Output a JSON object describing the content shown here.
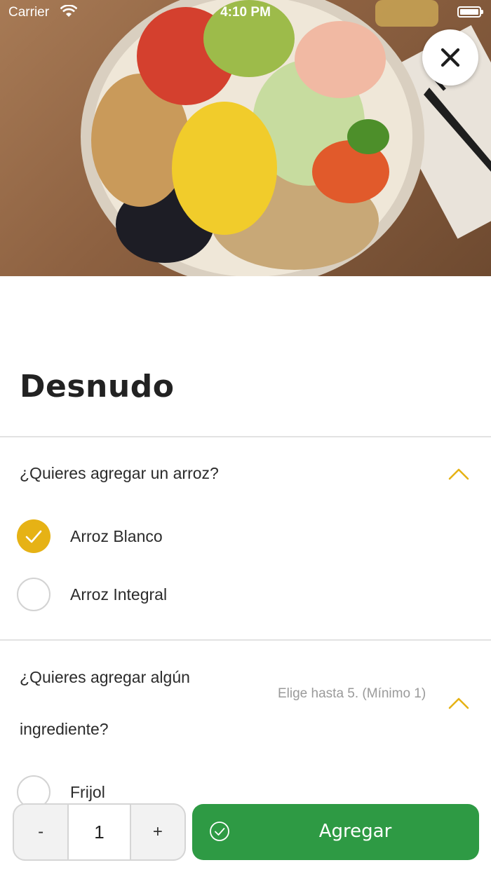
{
  "status_bar": {
    "carrier": "Carrier",
    "time": "4:10 PM"
  },
  "hero": {
    "image_description_icon": "food-photo-icon"
  },
  "product": {
    "title": "Desnudo"
  },
  "sections": [
    {
      "title": "¿Quieres agregar un arroz?",
      "options": [
        {
          "label": "Arroz Blanco",
          "selected": true
        },
        {
          "label": "Arroz Integral",
          "selected": false
        }
      ]
    },
    {
      "title_line1": "¿Quieres agregar algún",
      "title_line2": "ingrediente?",
      "hint": "Elige hasta 5. (Mínimo 1)",
      "options": [
        {
          "label": "Frijol",
          "selected": false
        }
      ]
    }
  ],
  "bottom_bar": {
    "decrement_label": "-",
    "quantity": "1",
    "increment_label": "+",
    "add_label": "Agregar"
  },
  "colors": {
    "accent_yellow": "#e6b215",
    "primary_green": "#2e9a44",
    "divider": "#e2e2e2",
    "hint_gray": "#9a9a9a"
  }
}
